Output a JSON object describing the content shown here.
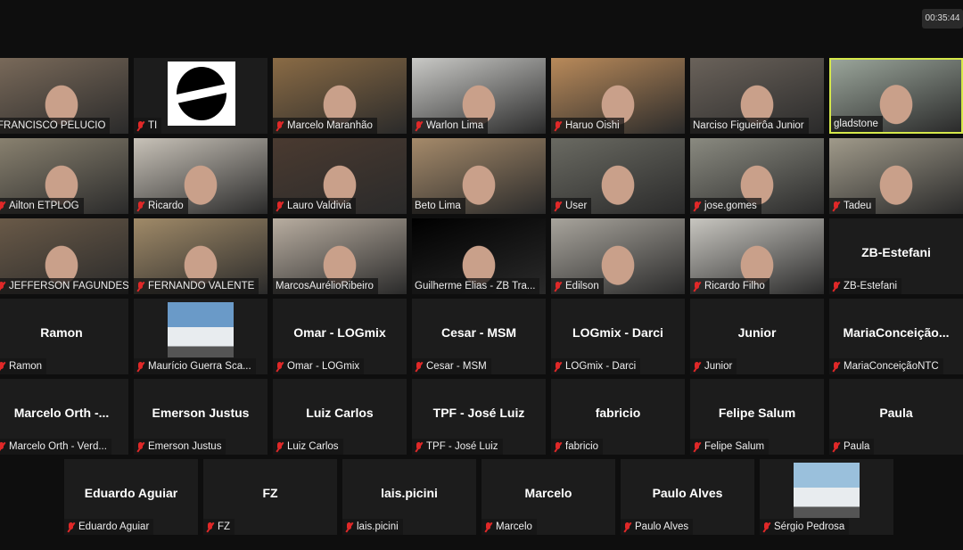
{
  "meeting": {
    "elapsed_time": "00:35:44"
  },
  "rows": [
    [
      {
        "name": "FRANCISCO PELUCIO",
        "muted": false,
        "type": "video",
        "color": "#7a6a5a"
      },
      {
        "name": "TI",
        "muted": true,
        "type": "logo"
      },
      {
        "name": "Marcelo Maranhão",
        "muted": true,
        "type": "video",
        "color": "#8a6b45"
      },
      {
        "name": "Warlon Lima",
        "muted": true,
        "type": "video",
        "color": "#c9c9c6"
      },
      {
        "name": "Haruo Oishi",
        "muted": true,
        "type": "video",
        "color": "#b98a5a"
      },
      {
        "name": "Narciso Figueirôa Junior",
        "muted": false,
        "type": "video",
        "color": "#6a625a"
      },
      {
        "name": "gladstone",
        "muted": false,
        "type": "video",
        "color": "#9aa59a",
        "speaker": true
      }
    ],
    [
      {
        "name": "Ailton ETPLOG",
        "muted": true,
        "type": "video",
        "color": "#8a8270"
      },
      {
        "name": "Ricardo",
        "muted": true,
        "type": "video",
        "color": "#c8c2b8"
      },
      {
        "name": "Lauro Valdivia",
        "muted": true,
        "type": "video",
        "color": "#4a3a30"
      },
      {
        "name": "Beto Lima",
        "muted": false,
        "type": "video",
        "color": "#a58a6a"
      },
      {
        "name": "User",
        "muted": true,
        "type": "video",
        "color": "#6a6a62"
      },
      {
        "name": "jose.gomes",
        "muted": true,
        "type": "video",
        "color": "#8a8a80"
      },
      {
        "name": "Tadeu",
        "muted": true,
        "type": "video",
        "color": "#a09a8a"
      }
    ],
    [
      {
        "name": "JEFFERSON FAGUNDES",
        "muted": true,
        "type": "video",
        "color": "#6a5a48"
      },
      {
        "name": "FERNANDO VALENTE",
        "muted": true,
        "type": "video",
        "color": "#a08a68"
      },
      {
        "name": "MarcosAurélioRibeiro",
        "muted": false,
        "type": "video",
        "color": "#b8ada0"
      },
      {
        "name": "Guilherme Elias - ZB Tra...",
        "muted": false,
        "type": "video",
        "color": "#000000"
      },
      {
        "name": "Edilson",
        "muted": true,
        "type": "video",
        "color": "#a8a49c"
      },
      {
        "name": "Ricardo Filho",
        "muted": true,
        "type": "video",
        "color": "#c8c6c0"
      },
      {
        "name": "ZB-Estefani",
        "title": "ZB-Estefani",
        "muted": true,
        "type": "name"
      }
    ],
    [
      {
        "name": "Ramon",
        "title": "Ramon",
        "muted": true,
        "type": "name"
      },
      {
        "name": "Maurício Guerra Sca...",
        "muted": true,
        "type": "picture",
        "color": "#6a9ac8"
      },
      {
        "name": "Omar - LOGmix",
        "title": "Omar - LOGmix",
        "muted": true,
        "type": "name"
      },
      {
        "name": "Cesar - MSM",
        "title": "Cesar - MSM",
        "muted": true,
        "type": "name"
      },
      {
        "name": "LOGmix - Darci",
        "title": "LOGmix - Darci",
        "muted": true,
        "type": "name"
      },
      {
        "name": "Junior",
        "title": "Junior",
        "muted": true,
        "type": "name"
      },
      {
        "name": "MariaConceiçãoNTC",
        "title": "MariaConceição...",
        "muted": true,
        "type": "name"
      }
    ],
    [
      {
        "name": "Marcelo Orth  - Verd...",
        "title": "Marcelo Orth  -...",
        "muted": true,
        "type": "name"
      },
      {
        "name": "Emerson Justus",
        "title": "Emerson Justus",
        "muted": true,
        "type": "name"
      },
      {
        "name": "Luiz Carlos",
        "title": "Luiz Carlos",
        "muted": true,
        "type": "name"
      },
      {
        "name": "TPF - José Luiz",
        "title": "TPF - José Luiz",
        "muted": true,
        "type": "name"
      },
      {
        "name": "fabricio",
        "title": "fabricio",
        "muted": true,
        "type": "name"
      },
      {
        "name": "Felipe Salum",
        "title": "Felipe Salum",
        "muted": true,
        "type": "name"
      },
      {
        "name": "Paula",
        "title": "Paula",
        "muted": true,
        "type": "name"
      }
    ],
    [
      {
        "name": "Eduardo Aguiar",
        "title": "Eduardo Aguiar",
        "muted": true,
        "type": "name"
      },
      {
        "name": "FZ",
        "title": "FZ",
        "muted": true,
        "type": "name"
      },
      {
        "name": "lais.picini",
        "title": "lais.picini",
        "muted": true,
        "type": "name"
      },
      {
        "name": "Marcelo",
        "title": "Marcelo",
        "muted": true,
        "type": "name"
      },
      {
        "name": "Paulo Alves",
        "title": "Paulo Alves",
        "muted": true,
        "type": "name"
      },
      {
        "name": "Sérgio Pedrosa",
        "muted": true,
        "type": "picture",
        "color": "#9ac0dc"
      }
    ]
  ]
}
